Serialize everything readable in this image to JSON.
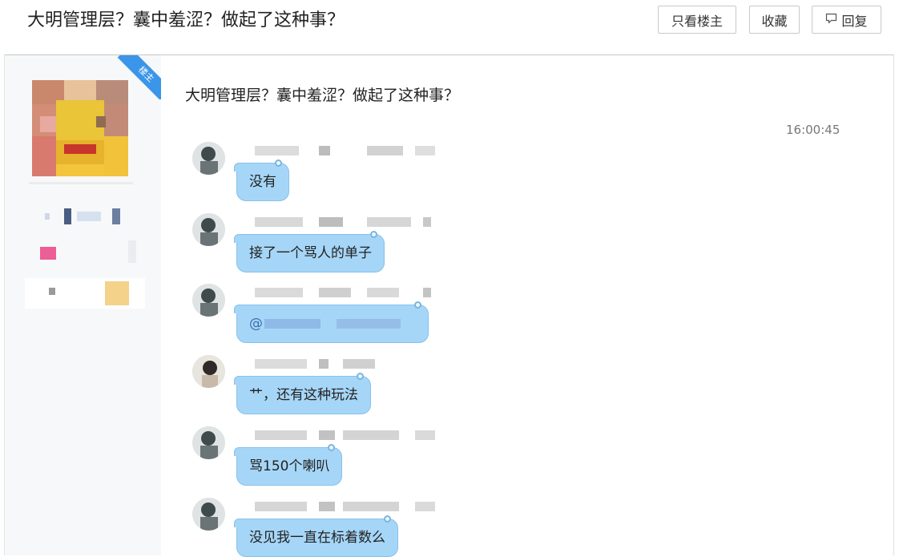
{
  "header": {
    "title": "大明管理层？囊中羞涩？做起了这种事？",
    "buttons": {
      "only_op": "只看楼主",
      "favorite": "收藏",
      "reply": "回复"
    }
  },
  "op_badge": "楼主",
  "post": {
    "title": "大明管理层？囊中羞涩？做起了这种事？",
    "time": "16:00:45"
  },
  "messages": [
    {
      "text": "没有"
    },
    {
      "text": "接了一个骂人的单子"
    },
    {
      "text": "@"
    },
    {
      "text": "艹，还有这种玩法"
    },
    {
      "text": "骂150个喇叭"
    },
    {
      "text": "没见我一直在标着数么"
    }
  ],
  "colors": {
    "bubble": "#a6d6f7",
    "badge": "#3b95e8",
    "sidebar": "#f7f8fa"
  }
}
